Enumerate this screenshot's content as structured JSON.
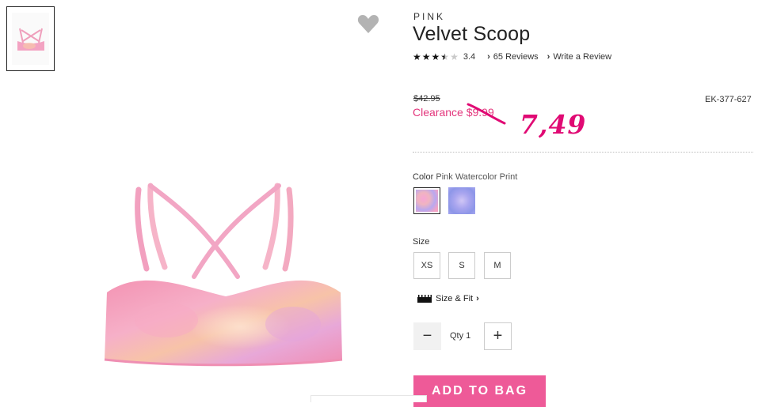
{
  "product": {
    "brand": "PINK",
    "title": "Velvet Scoop",
    "rating": 3.4,
    "rating_text": "3.4",
    "reviews_link": "65 Reviews",
    "write_review_link": "Write a Review",
    "original_price": "$42.95",
    "clearance_price": "Clearance $9.99",
    "sku": "EK-377-627",
    "handwritten_note": "7,49",
    "color_label": "Color",
    "color_value": "Pink Watercolor Print",
    "swatches": [
      {
        "name": "pink watercolor",
        "selected": true
      },
      {
        "name": "purple watercolor",
        "selected": false
      }
    ],
    "size_label": "Size",
    "sizes": [
      "XS",
      "S",
      "M"
    ],
    "size_fit_link": "Size & Fit",
    "qty_label": "Qty 1",
    "qty_value": 1,
    "add_to_bag": "ADD TO BAG"
  },
  "colors": {
    "accent_pink": "#ee5a98",
    "clearance_pink": "#e3367c",
    "handwritten_pink": "#e00a74"
  },
  "icons": {
    "heart": "heart-icon",
    "chevron": "chevron-right-icon",
    "ruler": "ruler-icon",
    "minus": "minus-icon",
    "plus": "plus-icon"
  }
}
